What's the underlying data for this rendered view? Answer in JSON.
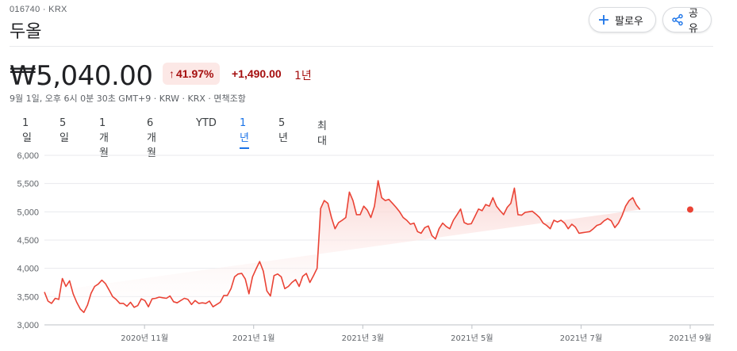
{
  "header": {
    "ticker_line": "016740 · KRX",
    "company_name": "두올",
    "follow_label": "팔로우",
    "share_label": "공유"
  },
  "quote": {
    "price": "₩5,040.00",
    "pct_change": "41.97%",
    "abs_change": "+1,490.00",
    "period": "1년",
    "meta": "9월 1일, 오후 6시 0분 30초 GMT+9 · KRW · KRX · 면책조항"
  },
  "ranges": [
    {
      "label": "1일",
      "active": false
    },
    {
      "label": "5일",
      "active": false
    },
    {
      "label": "1개월",
      "active": false
    },
    {
      "label": "6개월",
      "active": false
    },
    {
      "label": "YTD",
      "active": false
    },
    {
      "label": "1년",
      "active": true
    },
    {
      "label": "5년",
      "active": false
    },
    {
      "label": "최대",
      "active": false
    }
  ],
  "colors": {
    "line": "#ea4335",
    "fill_top": "#fad2cf",
    "grid": "#e8eaed",
    "accent": "#1a73e8",
    "negative_text": "#a50e0e"
  },
  "chart_data": {
    "type": "area",
    "ylim": [
      3000,
      6000
    ],
    "yticks": [
      "6,000",
      "5,500",
      "5,000",
      "4,500",
      "4,000",
      "3,500",
      "3,000"
    ],
    "x_labels": [
      "2020년 11월",
      "2021년 1월",
      "2021년 3월",
      "2021년 5월",
      "2021년 7월",
      "2021년 9월"
    ],
    "x": [
      0,
      2,
      4,
      6,
      8,
      10,
      12,
      14,
      16,
      18,
      20,
      22,
      24,
      26,
      28,
      30,
      32,
      34,
      36,
      38,
      40,
      42,
      44,
      46,
      48,
      50,
      52,
      54,
      56,
      58,
      60,
      62,
      64,
      66,
      68,
      70,
      72,
      74,
      76,
      78,
      80,
      82,
      84,
      86,
      88,
      90,
      92,
      94,
      96,
      98,
      100,
      102,
      104,
      106,
      108,
      110,
      112,
      114,
      116,
      118,
      120,
      122,
      124,
      126,
      128,
      130,
      132,
      134,
      136,
      138,
      140,
      142,
      144,
      146,
      148,
      150,
      152,
      154,
      156,
      158,
      160,
      162,
      164,
      166,
      168,
      170,
      172,
      174,
      176,
      178,
      180,
      182,
      184,
      186,
      188,
      190,
      192,
      194,
      196,
      198,
      200,
      202,
      204,
      206,
      208,
      210,
      212,
      214,
      216,
      218,
      220,
      222,
      224,
      226,
      228,
      230,
      232,
      234,
      236,
      238,
      240,
      242,
      244,
      246,
      248,
      250,
      252,
      254,
      256,
      258,
      260,
      262,
      264,
      266,
      268,
      270,
      272,
      274,
      276,
      278,
      280,
      282,
      284,
      286,
      288,
      290,
      292,
      294,
      296,
      298,
      300,
      302,
      304,
      306,
      308,
      310,
      312,
      314,
      316,
      318,
      320,
      322,
      324,
      326,
      328,
      330,
      332,
      334,
      336,
      338,
      340,
      342,
      344,
      346,
      348,
      350,
      352,
      354,
      356,
      358,
      360
    ],
    "values": [
      3580,
      3420,
      3380,
      3470,
      3450,
      3820,
      3680,
      3780,
      3550,
      3400,
      3280,
      3220,
      3350,
      3560,
      3680,
      3720,
      3790,
      3730,
      3620,
      3500,
      3450,
      3380,
      3380,
      3330,
      3400,
      3310,
      3340,
      3460,
      3430,
      3320,
      3460,
      3470,
      3490,
      3480,
      3470,
      3510,
      3410,
      3390,
      3430,
      3470,
      3450,
      3360,
      3430,
      3380,
      3390,
      3380,
      3420,
      3320,
      3360,
      3400,
      3520,
      3520,
      3640,
      3850,
      3900,
      3910,
      3810,
      3550,
      3850,
      3990,
      4120,
      3950,
      3600,
      3510,
      3870,
      3900,
      3850,
      3640,
      3680,
      3750,
      3800,
      3680,
      3860,
      3910,
      3750,
      3870,
      4000,
      5060,
      5200,
      5150,
      4900,
      4700,
      4810,
      4850,
      4900,
      5350,
      5200,
      4950,
      4950,
      5100,
      5030,
      4900,
      5100,
      5550,
      5250,
      5200,
      5220,
      5150,
      5080,
      5000,
      4900,
      4850,
      4780,
      4800,
      4650,
      4620,
      4720,
      4750,
      4580,
      4520,
      4700,
      4800,
      4740,
      4700,
      4850,
      4950,
      5050,
      4810,
      4780,
      4790,
      4920,
      5050,
      5020,
      5130,
      5100,
      5250,
      5100,
      5020,
      4950,
      5080,
      5150,
      5420,
      4950,
      4940,
      4990,
      5000,
      5010,
      4960,
      4900,
      4800,
      4760,
      4700,
      4850,
      4820,
      4850,
      4800,
      4700,
      4780,
      4730,
      4620,
      4630,
      4640,
      4650,
      4700,
      4760,
      4780,
      4840,
      4880,
      4840,
      4720,
      4800,
      4930,
      5100,
      5200,
      5250,
      5120,
      5040
    ]
  }
}
